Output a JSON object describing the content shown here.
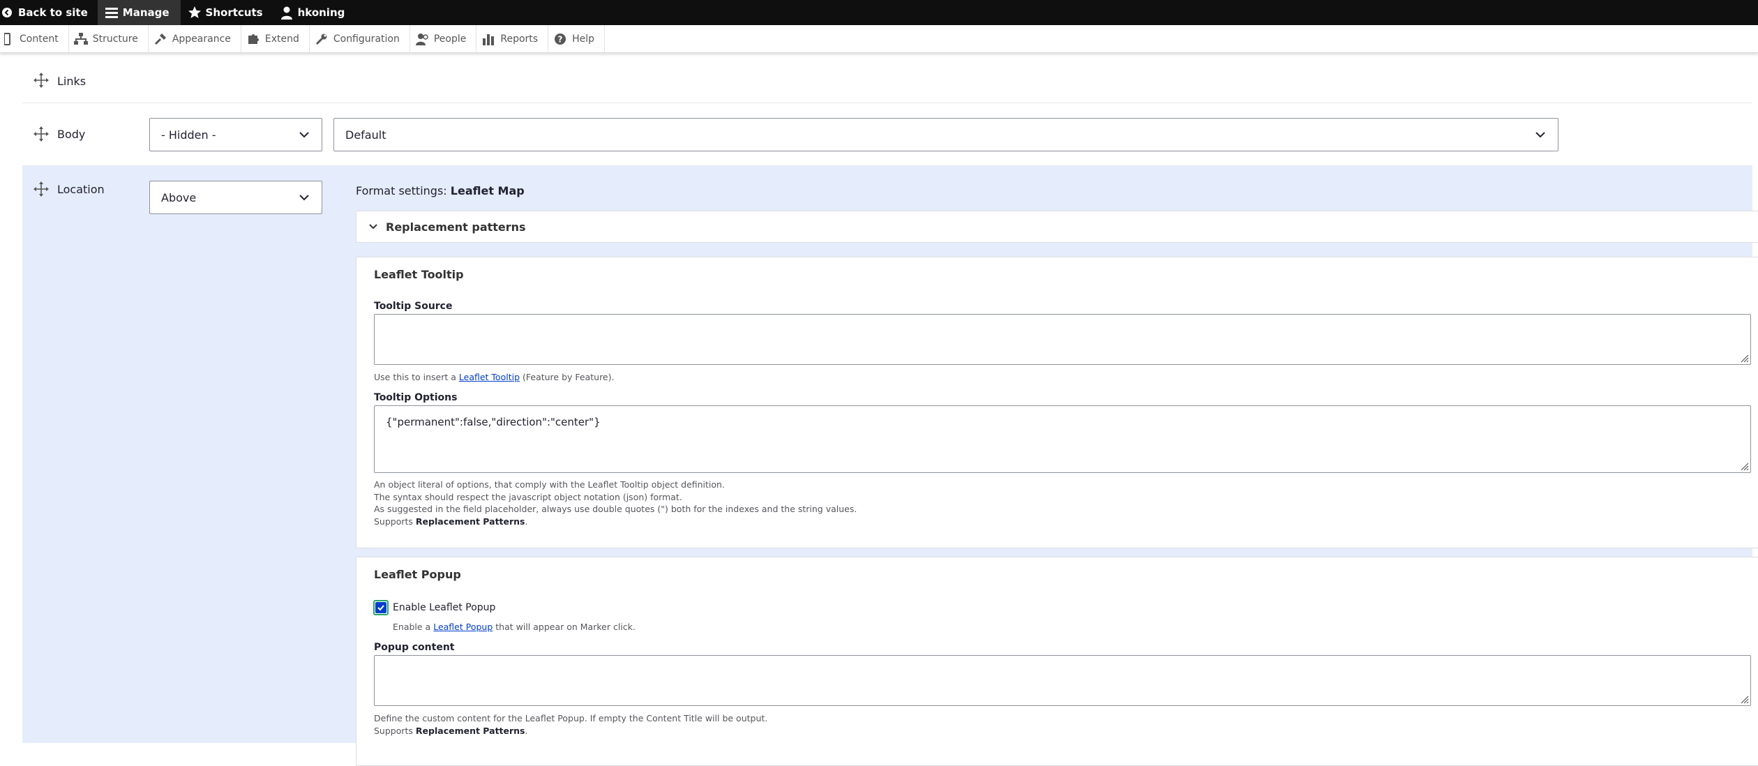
{
  "toolbar": {
    "back_label": "Back to site",
    "manage_label": "Manage",
    "shortcuts_label": "Shortcuts",
    "user_label": "hkoning"
  },
  "tray": {
    "items": [
      {
        "label": "Content",
        "icon": "content-icon"
      },
      {
        "label": "Structure",
        "icon": "structure-icon"
      },
      {
        "label": "Appearance",
        "icon": "appearance-icon"
      },
      {
        "label": "Extend",
        "icon": "extend-icon"
      },
      {
        "label": "Configuration",
        "icon": "wrench-icon"
      },
      {
        "label": "People",
        "icon": "people-icon"
      },
      {
        "label": "Reports",
        "icon": "reports-icon"
      },
      {
        "label": "Help",
        "icon": "help-icon"
      }
    ]
  },
  "fields": {
    "links": {
      "label": "Links"
    },
    "body": {
      "label": "Body",
      "label_display": "- Hidden -",
      "format": "Default"
    },
    "location": {
      "label": "Location",
      "label_display": "Above"
    }
  },
  "format_settings": {
    "prefix": "Format settings:",
    "name": "Leaflet Map",
    "replacement_patterns": "Replacement patterns"
  },
  "tooltip": {
    "heading": "Leaflet Tooltip",
    "source_label": "Tooltip Source",
    "source_value": "",
    "source_help_prefix": "Use this to insert a",
    "source_help_link": "Leaflet Tooltip",
    "source_help_suffix": "(Feature by Feature).",
    "options_label": "Tooltip Options",
    "options_value": "{\"permanent\":false,\"direction\":\"center\"}",
    "options_help_1": "An object literal of options, that comply with the Leaflet Tooltip object definition.",
    "options_help_2": "The syntax should respect the javascript object notation (json) format.",
    "options_help_3": "As suggested in the field placeholder, always use double quotes (\") both for the indexes and the string values.",
    "supports_prefix": "Supports",
    "supports_bold": "Replacement Patterns",
    "supports_suffix": "."
  },
  "popup": {
    "heading": "Leaflet Popup",
    "enable_label": "Enable Leaflet Popup",
    "enable_checked": true,
    "enable_help_prefix": "Enable a",
    "enable_help_link": "Leaflet Popup",
    "enable_help_suffix": "that will appear on Marker click.",
    "content_label": "Popup content",
    "content_value": "",
    "content_help": "Define the custom content for the Leaflet Popup. If empty the Content Title will be output.",
    "supports_prefix": "Supports",
    "supports_bold": "Replacement Patterns",
    "supports_suffix": "."
  },
  "colors": {
    "toolbar_bg": "#0f0f0f",
    "row_highlight": "#e5ecfb",
    "link": "#003ecc",
    "checkbox_focus": "#26a769"
  }
}
